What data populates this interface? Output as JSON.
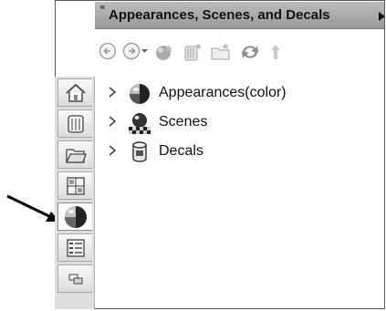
{
  "panel": {
    "title": "Appearances, Scenes, and Decals",
    "collapse_glyph": "«"
  },
  "toolbar": {
    "buttons": [
      {
        "icon": "back-arrow-icon"
      },
      {
        "icon": "forward-arrow-dropdown-icon"
      },
      {
        "icon": "add-appearance-icon"
      },
      {
        "icon": "add-file-location-icon"
      },
      {
        "icon": "new-folder-icon"
      },
      {
        "icon": "refresh-icon"
      },
      {
        "icon": "up-one-level-icon"
      }
    ]
  },
  "tree": {
    "items": [
      {
        "label": "Appearances(color)",
        "icon": "appearance-sphere-icon"
      },
      {
        "label": "Scenes",
        "icon": "scene-icon"
      },
      {
        "label": "Decals",
        "icon": "decal-cylinder-icon"
      }
    ]
  },
  "task_pane_tabs": [
    {
      "icon": "home-icon",
      "active": false
    },
    {
      "icon": "design-library-icon",
      "active": false
    },
    {
      "icon": "file-explorer-icon",
      "active": false
    },
    {
      "icon": "view-palette-icon",
      "active": false
    },
    {
      "icon": "appearances-scenes-decals-icon",
      "active": true
    },
    {
      "icon": "custom-properties-icon",
      "active": false
    },
    {
      "icon": "forum-icon",
      "active": false
    }
  ],
  "colors": {
    "header_bg": "#a9a9a9",
    "tab_strip_bg": "#dedede",
    "icon_gray": "#8c8c8c"
  }
}
